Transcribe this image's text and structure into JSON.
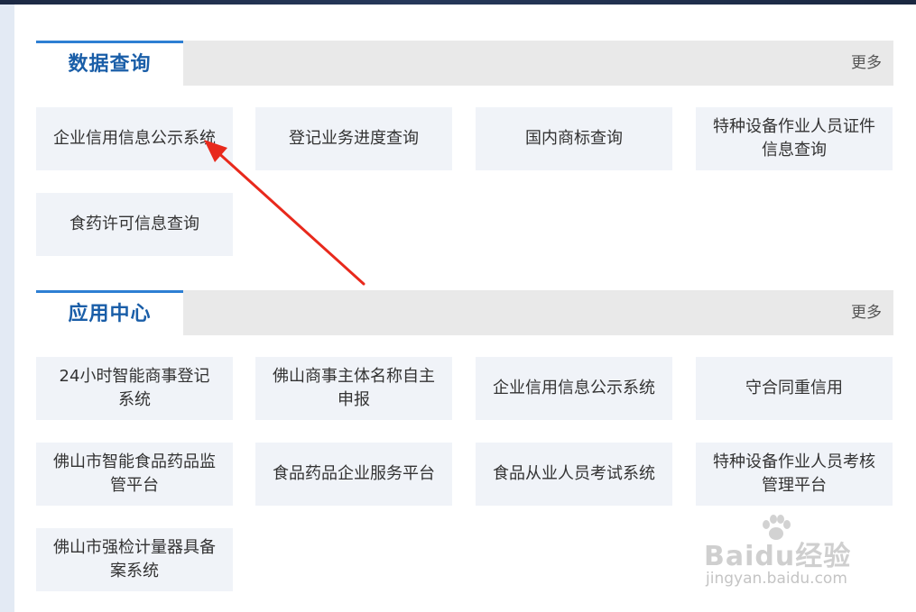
{
  "sections": [
    {
      "title": "数据查询",
      "more_label": "更多",
      "tiles": [
        "企业信用信息公示系统",
        "登记业务进度查询",
        "国内商标查询",
        "特种设备作业人员证件信息查询",
        "食药许可信息查询"
      ]
    },
    {
      "title": "应用中心",
      "more_label": "更多",
      "tiles": [
        "24小时智能商事登记系统",
        "佛山商事主体名称自主申报",
        "企业信用信息公示系统",
        "守合同重信用",
        "佛山市智能食品药品监管平台",
        "食品药品企业服务平台",
        "食品从业人员考试系统",
        "特种设备作业人员考核管理平台",
        "佛山市强检计量器具备案系统"
      ]
    }
  ],
  "watermark": {
    "logo_text": "Baidu经验",
    "url_text": "jingyan.baidu.com"
  },
  "colors": {
    "tab_accent": "#2d7fd3",
    "tab_title": "#1a5ea8",
    "tile_bg": "#f0f3f8",
    "arrow": "#e8291c"
  },
  "icons": [
    "red-arrow-annotation",
    "baidu-paw-icon"
  ]
}
